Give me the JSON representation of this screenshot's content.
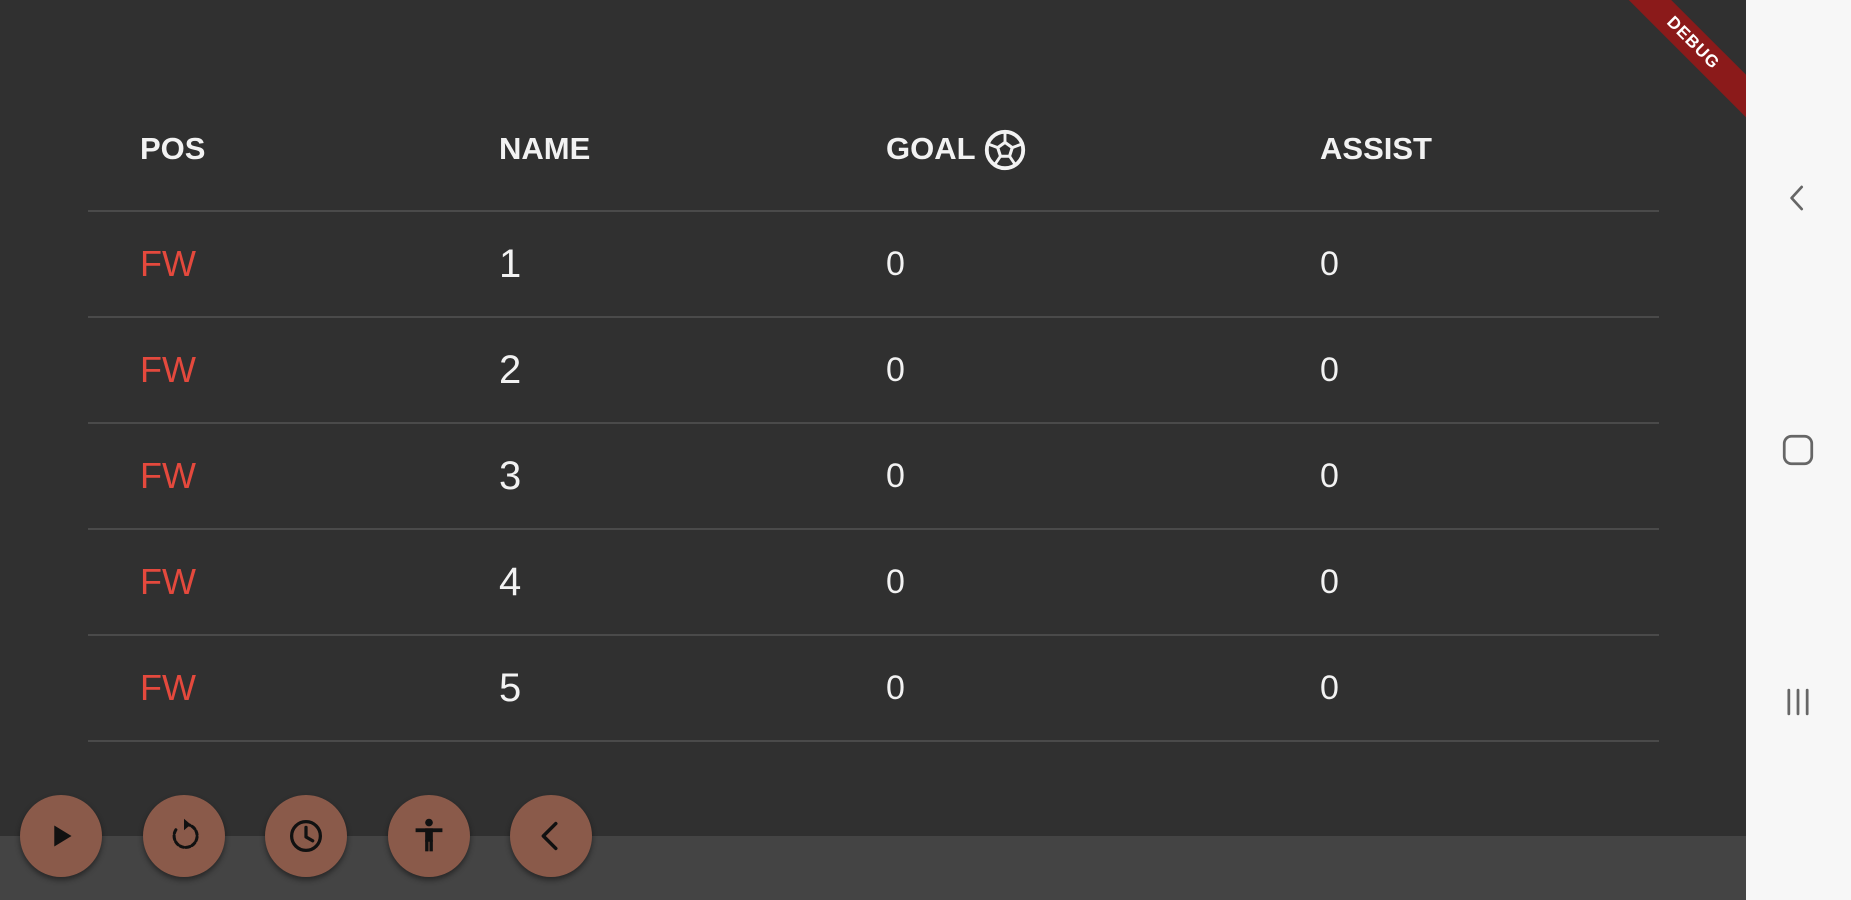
{
  "debug_banner": "DEBUG",
  "table": {
    "headers": {
      "pos": "POS",
      "name": "NAME",
      "goal": "GOAL",
      "assist": "ASSIST"
    },
    "goal_header_icon": "soccer-ball-icon",
    "rows": [
      {
        "pos": "FW",
        "name": "1",
        "goal": "0",
        "assist": "0"
      },
      {
        "pos": "FW",
        "name": "2",
        "goal": "0",
        "assist": "0"
      },
      {
        "pos": "FW",
        "name": "3",
        "goal": "0",
        "assist": "0"
      },
      {
        "pos": "FW",
        "name": "4",
        "goal": "0",
        "assist": "0"
      },
      {
        "pos": "FW",
        "name": "5",
        "goal": "0",
        "assist": "0"
      }
    ]
  },
  "fab_buttons": [
    {
      "icon": "play-icon"
    },
    {
      "icon": "refresh-icon"
    },
    {
      "icon": "clock-icon"
    },
    {
      "icon": "accessibility-icon"
    },
    {
      "icon": "chevron-left-icon"
    }
  ],
  "system_nav": [
    {
      "icon": "back-icon"
    },
    {
      "icon": "home-icon"
    },
    {
      "icon": "recents-icon"
    }
  ],
  "colors": {
    "background": "#303030",
    "position_text": "#e4493d",
    "fab": "#8a5a4a",
    "debug_banner": "#8b1a1a",
    "nav_bar": "#f7f7f7"
  }
}
